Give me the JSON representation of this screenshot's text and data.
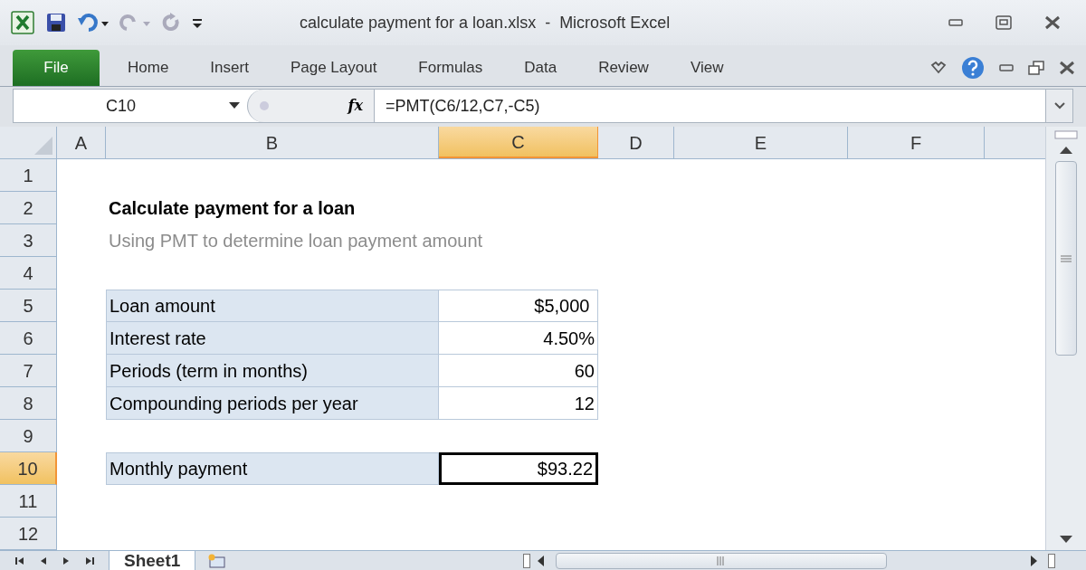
{
  "window": {
    "title": "calculate payment for a loan.xlsx  -  Microsoft Excel"
  },
  "ribbon_tabs": [
    {
      "label": "File",
      "kind": "file"
    },
    {
      "label": "Home",
      "kind": "tab"
    },
    {
      "label": "Insert",
      "kind": "tab"
    },
    {
      "label": "Page Layout",
      "kind": "tab"
    },
    {
      "label": "Formulas",
      "kind": "tab"
    },
    {
      "label": "Data",
      "kind": "tab"
    },
    {
      "label": "Review",
      "kind": "tab"
    },
    {
      "label": "View",
      "kind": "tab"
    }
  ],
  "formula_bar": {
    "name_box": "C10",
    "fx": "fx",
    "formula": "=PMT(C6/12,C7,-C5)"
  },
  "columns": [
    {
      "label": "A",
      "selected": false
    },
    {
      "label": "B",
      "selected": false
    },
    {
      "label": "C",
      "selected": true
    },
    {
      "label": "D",
      "selected": false
    },
    {
      "label": "E",
      "selected": false
    },
    {
      "label": "F",
      "selected": false
    }
  ],
  "rows": [
    {
      "number": "1",
      "selected": false,
      "kind": "blank"
    },
    {
      "number": "2",
      "selected": false,
      "kind": "title",
      "label": "Calculate payment for a loan"
    },
    {
      "number": "3",
      "selected": false,
      "kind": "subtitle",
      "label": "Using PMT to determine loan payment amount"
    },
    {
      "number": "4",
      "selected": false,
      "kind": "blank"
    },
    {
      "number": "5",
      "selected": false,
      "kind": "input",
      "label": "Loan amount",
      "value": "$5,000 ",
      "active": false
    },
    {
      "number": "6",
      "selected": false,
      "kind": "input",
      "label": "Interest rate",
      "value": "4.50%",
      "active": false
    },
    {
      "number": "7",
      "selected": false,
      "kind": "input",
      "label": "Periods (term in months)",
      "value": "60",
      "active": false
    },
    {
      "number": "8",
      "selected": false,
      "kind": "input",
      "label": "Compounding periods per year",
      "value": "12",
      "active": false
    },
    {
      "number": "9",
      "selected": false,
      "kind": "blank"
    },
    {
      "number": "10",
      "selected": true,
      "kind": "result",
      "label": "Monthly payment",
      "value": "$93.22",
      "active": true
    },
    {
      "number": "11",
      "selected": false,
      "kind": "blank"
    },
    {
      "number": "12",
      "selected": false,
      "kind": "blank"
    }
  ],
  "sheet_tabs": [
    {
      "label": "Sheet1",
      "selected": true
    }
  ]
}
